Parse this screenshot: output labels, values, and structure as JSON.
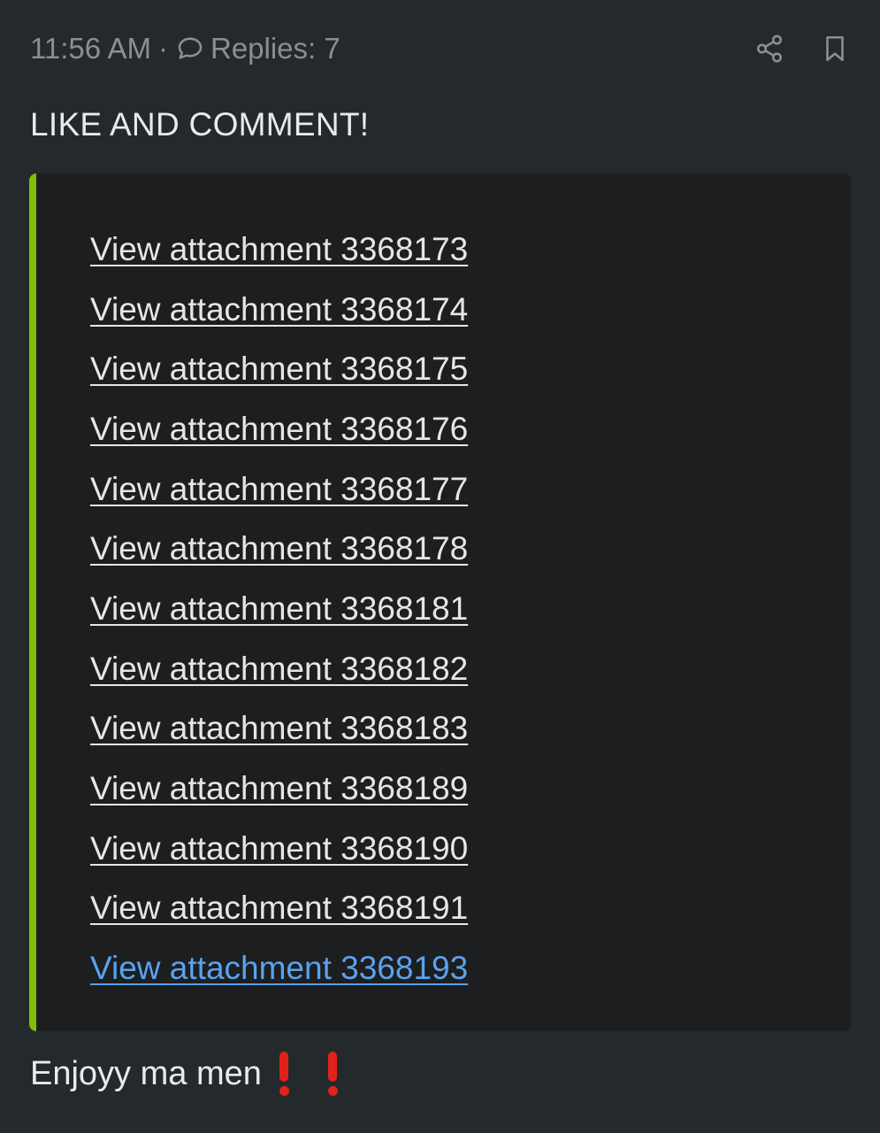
{
  "meta": {
    "time": "11:56 AM",
    "separator": "·",
    "replies": "Replies: 7",
    "icons": {
      "replies": "comment-bubble-icon",
      "share": "share-icon",
      "bookmark": "bookmark-icon"
    }
  },
  "post": {
    "headline": "LIKE AND COMMENT!",
    "attachments": [
      "View attachment 3368173",
      "View attachment 3368174",
      "View attachment 3368175",
      "View attachment 3368176",
      "View attachment 3368177",
      "View attachment 3368178",
      "View attachment 3368181",
      "View attachment 3368182",
      "View attachment 3368183",
      "View attachment 3368189",
      "View attachment 3368190",
      "View attachment 3368191",
      "View attachment 3368193"
    ],
    "footer": "Enjoyy ma men",
    "footer_emoji": "heavy-exclamation-mark-emoji"
  },
  "colors": {
    "background": "#24292c",
    "quote_background": "#1c1e1f",
    "quote_border": "#7fbf00",
    "link": "#e6e6e6",
    "link_visited": "#5aa2ee",
    "meta_text": "#8a8f93",
    "emoji_red": "#e0221b"
  }
}
